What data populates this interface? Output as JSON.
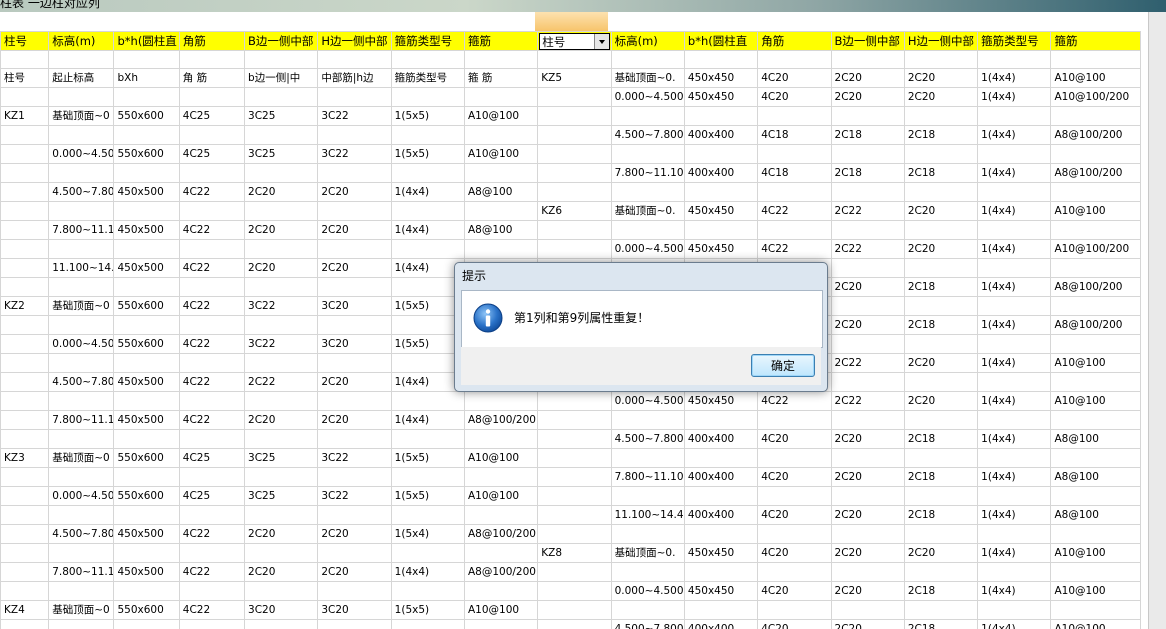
{
  "window": {
    "title": "柱表 一边柱对应列"
  },
  "header": [
    "柱号",
    "标高(m)",
    "b*h(圆柱直",
    "角筋",
    "B边一侧中部",
    "H边一侧中部",
    "箍筋类型号",
    "箍筋",
    "柱号",
    "标高(m)",
    "b*h(圆柱直",
    "角筋",
    "B边一侧中部",
    "H边一侧中部",
    "箍筋类型号",
    "箍筋"
  ],
  "selected_header": {
    "value": "柱号"
  },
  "rows": [
    [
      "",
      "",
      "",
      "",
      "",
      "",
      "",
      "",
      "",
      "",
      "",
      "",
      "",
      "",
      "",
      ""
    ],
    [
      "柱号",
      "起止标高",
      "bXh",
      "角 筋",
      "b边一侧|中",
      "中部筋|h边",
      "箍筋类型号",
      "箍 筋",
      "KZ5",
      "基础顶面~0.",
      "450x450",
      "4C20",
      "2C20",
      "2C20",
      "1(4x4)",
      "A10@100"
    ],
    [
      "",
      "",
      "",
      "",
      "",
      "",
      "",
      "",
      "",
      "0.000~4.500",
      "450x450",
      "4C20",
      "2C20",
      "2C20",
      "1(4x4)",
      "A10@100/200"
    ],
    [
      "KZ1",
      "基础顶面~0",
      "550x600",
      "4C25",
      "3C25",
      "3C22",
      "1(5x5)",
      "A10@100",
      "",
      "",
      "",
      "",
      "",
      "",
      "",
      ""
    ],
    [
      "",
      "",
      "",
      "",
      "",
      "",
      "",
      "",
      "",
      "4.500~7.800",
      "400x400",
      "4C18",
      "2C18",
      "2C18",
      "1(4x4)",
      "A8@100/200"
    ],
    [
      "",
      "0.000~4.50",
      "550x600",
      "4C25",
      "3C25",
      "3C22",
      "1(5x5)",
      "A10@100",
      "",
      "",
      "",
      "",
      "",
      "",
      "",
      ""
    ],
    [
      "",
      "",
      "",
      "",
      "",
      "",
      "",
      "",
      "",
      "7.800~11.10",
      "400x400",
      "4C18",
      "2C18",
      "2C18",
      "1(4x4)",
      "A8@100/200"
    ],
    [
      "",
      "4.500~7.80",
      "450x500",
      "4C22",
      "2C20",
      "2C20",
      "1(4x4)",
      "A8@100",
      "",
      "",
      "",
      "",
      "",
      "",
      "",
      ""
    ],
    [
      "",
      "",
      "",
      "",
      "",
      "",
      "",
      "",
      "KZ6",
      "基础顶面~0.",
      "450x450",
      "4C22",
      "2C22",
      "2C20",
      "1(4x4)",
      "A10@100"
    ],
    [
      "",
      "7.800~11.1",
      "450x500",
      "4C22",
      "2C20",
      "2C20",
      "1(4x4)",
      "A8@100",
      "",
      "",
      "",
      "",
      "",
      "",
      "",
      ""
    ],
    [
      "",
      "",
      "",
      "",
      "",
      "",
      "",
      "",
      "",
      "0.000~4.500",
      "450x450",
      "4C22",
      "2C22",
      "2C20",
      "1(4x4)",
      "A10@100/200"
    ],
    [
      "",
      "11.100~14.",
      "450x500",
      "4C22",
      "2C20",
      "2C20",
      "1(4x4)",
      "",
      "",
      "",
      "",
      "",
      "",
      "",
      "",
      ""
    ],
    [
      "",
      "",
      "",
      "",
      "",
      "",
      "",
      "",
      "",
      "",
      "",
      "",
      "2C20",
      "2C18",
      "1(4x4)",
      "A8@100/200"
    ],
    [
      "KZ2",
      "基础顶面~0",
      "550x600",
      "4C22",
      "3C22",
      "3C20",
      "1(5x5)",
      "",
      "",
      "",
      "",
      "",
      "",
      "",
      "",
      ""
    ],
    [
      "",
      "",
      "",
      "",
      "",
      "",
      "",
      "",
      "",
      "",
      "",
      "",
      "2C20",
      "2C18",
      "1(4x4)",
      "A8@100/200"
    ],
    [
      "",
      "0.000~4.50",
      "550x600",
      "4C22",
      "3C22",
      "3C20",
      "1(5x5)",
      "",
      "",
      "",
      "",
      "",
      "",
      "",
      "",
      ""
    ],
    [
      "",
      "",
      "",
      "",
      "",
      "",
      "",
      "",
      "",
      "",
      "",
      "",
      "2C22",
      "2C20",
      "1(4x4)",
      "A10@100"
    ],
    [
      "",
      "4.500~7.80",
      "450x500",
      "4C22",
      "2C22",
      "2C20",
      "1(4x4)",
      "",
      "",
      "",
      "",
      "",
      "",
      "",
      "",
      ""
    ],
    [
      "",
      "",
      "",
      "",
      "",
      "",
      "",
      "",
      "",
      "0.000~4.500",
      "450x450",
      "4C22",
      "2C22",
      "2C20",
      "1(4x4)",
      "A10@100"
    ],
    [
      "",
      "7.800~11.1",
      "450x500",
      "4C22",
      "2C20",
      "2C20",
      "1(4x4)",
      "A8@100/200",
      "",
      "",
      "",
      "",
      "",
      "",
      "",
      ""
    ],
    [
      "",
      "",
      "",
      "",
      "",
      "",
      "",
      "",
      "",
      "4.500~7.800",
      "400x400",
      "4C20",
      "2C20",
      "2C18",
      "1(4x4)",
      "A8@100"
    ],
    [
      "KZ3",
      "基础顶面~0",
      "550x600",
      "4C25",
      "3C25",
      "3C22",
      "1(5x5)",
      "A10@100",
      "",
      "",
      "",
      "",
      "",
      "",
      "",
      ""
    ],
    [
      "",
      "",
      "",
      "",
      "",
      "",
      "",
      "",
      "",
      "7.800~11.10",
      "400x400",
      "4C20",
      "2C20",
      "2C18",
      "1(4x4)",
      "A8@100"
    ],
    [
      "",
      "0.000~4.50",
      "550x600",
      "4C25",
      "3C25",
      "3C22",
      "1(5x5)",
      "A10@100",
      "",
      "",
      "",
      "",
      "",
      "",
      "",
      ""
    ],
    [
      "",
      "",
      "",
      "",
      "",
      "",
      "",
      "",
      "",
      "11.100~14.4",
      "400x400",
      "4C20",
      "2C20",
      "2C18",
      "1(4x4)",
      "A8@100"
    ],
    [
      "",
      "4.500~7.80",
      "450x500",
      "4C22",
      "2C20",
      "2C20",
      "1(5x4)",
      "A8@100/200",
      "",
      "",
      "",
      "",
      "",
      "",
      "",
      ""
    ],
    [
      "",
      "",
      "",
      "",
      "",
      "",
      "",
      "",
      "KZ8",
      "基础顶面~0.",
      "450x450",
      "4C20",
      "2C20",
      "2C20",
      "1(4x4)",
      "A10@100"
    ],
    [
      "",
      "7.800~11.1",
      "450x500",
      "4C22",
      "2C20",
      "2C20",
      "1(4x4)",
      "A8@100/200",
      "",
      "",
      "",
      "",
      "",
      "",
      "",
      ""
    ],
    [
      "",
      "",
      "",
      "",
      "",
      "",
      "",
      "",
      "",
      "0.000~4.500",
      "450x450",
      "4C20",
      "2C20",
      "2C18",
      "1(4x4)",
      "A10@100"
    ],
    [
      "KZ4",
      "基础顶面~0",
      "550x600",
      "4C22",
      "3C20",
      "3C20",
      "1(5x5)",
      "A10@100",
      "",
      "",
      "",
      "",
      "",
      "",
      "",
      ""
    ],
    [
      "",
      "",
      "",
      "",
      "",
      "",
      "",
      "",
      "",
      "4.500~7.800",
      "400x400",
      "4C20",
      "2C20",
      "2C18",
      "1(4x4)",
      "A10@100"
    ]
  ],
  "dialog": {
    "title": "提示",
    "message": "第1列和第9列属性重复！",
    "ok_label": "确定",
    "icon": "info-icon"
  },
  "colors": {
    "header_bg": "#ffff00",
    "dialog_bg": "#dce6f0",
    "button_border": "#3c7fb1"
  }
}
